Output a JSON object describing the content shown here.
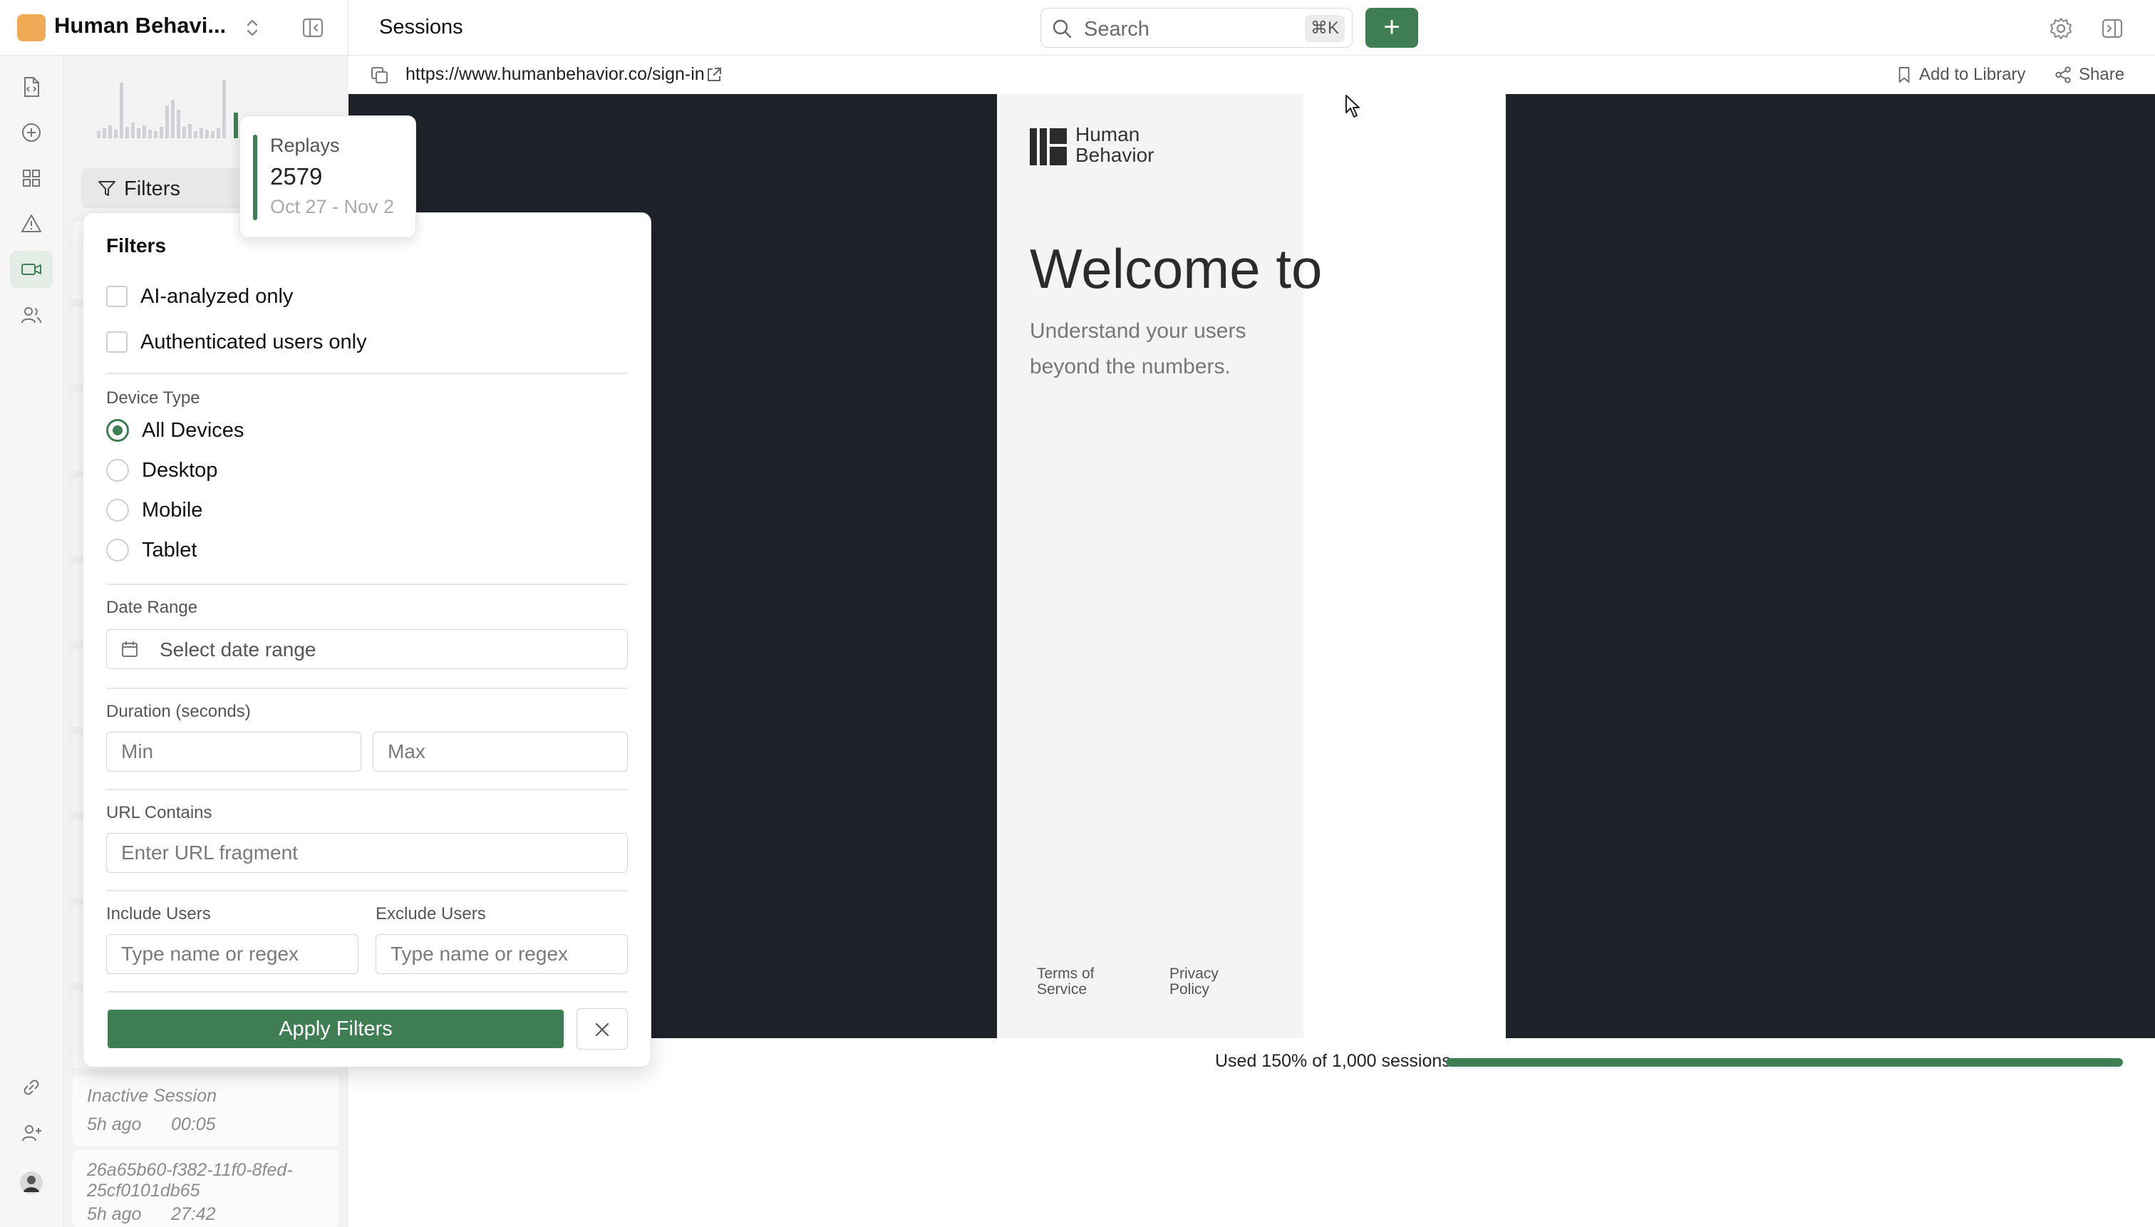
{
  "workspace": {
    "name": "Human Behavi...",
    "logo_color": "#f0a955"
  },
  "header": {
    "page_title": "Sessions",
    "search_placeholder": "Search",
    "search_shortcut": "⌘K",
    "new_label": "+"
  },
  "rail": {
    "active_item": "sessions"
  },
  "list": {
    "filters_label": "Filters",
    "sessions": [
      {
        "title": "Inactive Session",
        "ago": "5h ago",
        "duration": "00:05"
      },
      {
        "title": "26a65b60-f382-11f0-8fed-25cf0101db65",
        "ago": "5h ago",
        "duration": "27:42"
      }
    ]
  },
  "tooltip": {
    "label": "Replays",
    "value": "2579",
    "range": "Oct 27 - Nov 2"
  },
  "urlbar": {
    "url": "https://www.humanbehavior.co/sign-in",
    "add_to_library": "Add to Library",
    "share": "Share"
  },
  "replay": {
    "brand": "Human Behavior",
    "brand_line1": "Human",
    "brand_line2": "Behavior",
    "headline": "Welcome to",
    "tagline": "Understand your users beyond the numbers.",
    "terms_line1": "Terms of",
    "terms_line2": "Service",
    "privacy_line1": "Privacy",
    "privacy_line2": "Policy"
  },
  "usage": {
    "text": "Used 150% of 1,000 sessions",
    "progress": 1.0
  },
  "filters": {
    "title": "Filters",
    "ai_analyzed_label": "AI-analyzed only",
    "ai_analyzed_checked": false,
    "authenticated_label": "Authenticated users only",
    "authenticated_checked": false,
    "device_type_label": "Device Type",
    "device_options": [
      "All Devices",
      "Desktop",
      "Mobile",
      "Tablet"
    ],
    "device_selected": "All Devices",
    "date_range_label": "Date Range",
    "date_range_placeholder": "Select date range",
    "duration_label": "Duration (seconds)",
    "duration_min_placeholder": "Min",
    "duration_max_placeholder": "Max",
    "url_contains_label": "URL Contains",
    "url_placeholder": "Enter URL fragment",
    "include_users_label": "Include Users",
    "include_users_placeholder": "Type name or regex",
    "exclude_users_label": "Exclude Users",
    "exclude_users_placeholder": "Type name or regex",
    "apply_label": "Apply Filters"
  },
  "colors": {
    "accent": "#3f7e52",
    "replay_bg": "#1e2229"
  }
}
